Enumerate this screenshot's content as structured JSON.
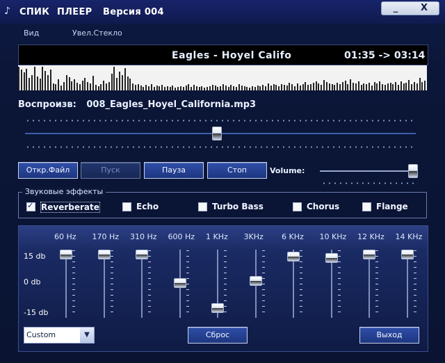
{
  "window": {
    "app_title": "СПИК",
    "player_title": "ПЛЕЕР",
    "version_title": "Версия 004",
    "minimize_label": "_",
    "close_label": "X"
  },
  "menu": {
    "view": "Вид",
    "magnifier": "Увел.Стекло"
  },
  "display": {
    "song": "Eagles - Hoyel Califo",
    "time": "01:35 -> 03:14"
  },
  "visualizer": {
    "bars": [
      34,
      30,
      26,
      31,
      18,
      22,
      34,
      20,
      17,
      34,
      28,
      22,
      30,
      10,
      9,
      16,
      7,
      12,
      22,
      19,
      13,
      16,
      11,
      9,
      14,
      18,
      12,
      10,
      21,
      8,
      6,
      9,
      14,
      10,
      12,
      24,
      34,
      18,
      27,
      22,
      32,
      20,
      17,
      10,
      8,
      9,
      7,
      5,
      8,
      6,
      9,
      5,
      7,
      6,
      8,
      5,
      6,
      5,
      7,
      4,
      5,
      6,
      5,
      7,
      9,
      5,
      8,
      6,
      5,
      6,
      4,
      5,
      6,
      8,
      7,
      5,
      6,
      9,
      7,
      5,
      8,
      6,
      5,
      9,
      7,
      6,
      5,
      4,
      6,
      5,
      7,
      6,
      8,
      6,
      10,
      7,
      9,
      8,
      6,
      9,
      8,
      7,
      11,
      9,
      6,
      10,
      7,
      9,
      12,
      8,
      9,
      11,
      13,
      10,
      8,
      15,
      12,
      10,
      9,
      8,
      11,
      9,
      12,
      14,
      9,
      16,
      11,
      10,
      13,
      8,
      10,
      9,
      11,
      7,
      12,
      10,
      13,
      9,
      8,
      10,
      11,
      9,
      12,
      8,
      13,
      10,
      11,
      15,
      9,
      12,
      10,
      18,
      12,
      14
    ]
  },
  "now_playing": {
    "label": "Воспроизв:",
    "filename": "008_Eagles_Hoyel_California.mp3",
    "position": 0.49
  },
  "controls": {
    "open_file": "Откр.Файл",
    "play": "Пуск",
    "pause": "Пауза",
    "stop": "Стоп",
    "volume_label": "Volume:",
    "volume_level": 0.98
  },
  "effects": {
    "title": "Звуковые эффекты",
    "items": [
      {
        "label": "Reverberate",
        "checked": true
      },
      {
        "label": "Echo",
        "checked": false
      },
      {
        "label": "Turbo Bass",
        "checked": false
      },
      {
        "label": "Chorus",
        "checked": false
      },
      {
        "label": "Flange",
        "checked": false
      }
    ]
  },
  "equalizer": {
    "db_labels": [
      "15 db",
      "0 db",
      "-15 db"
    ],
    "bands": [
      {
        "freq": "60 Hz",
        "level": 1.0
      },
      {
        "freq": "170 Hz",
        "level": 1.0
      },
      {
        "freq": "310 Hz",
        "level": 1.0
      },
      {
        "freq": "600 Hz",
        "level": 0.52
      },
      {
        "freq": "1 KHz",
        "level": 0.1
      },
      {
        "freq": "3KHz",
        "level": 0.56
      },
      {
        "freq": "6 KHz",
        "level": 0.97
      },
      {
        "freq": "10 KHz",
        "level": 0.94
      },
      {
        "freq": "12 KHz",
        "level": 1.0
      },
      {
        "freq": "14 KHz",
        "level": 1.0
      }
    ],
    "preset": "Custom",
    "reset": "Сброс",
    "exit": "Выход"
  }
}
